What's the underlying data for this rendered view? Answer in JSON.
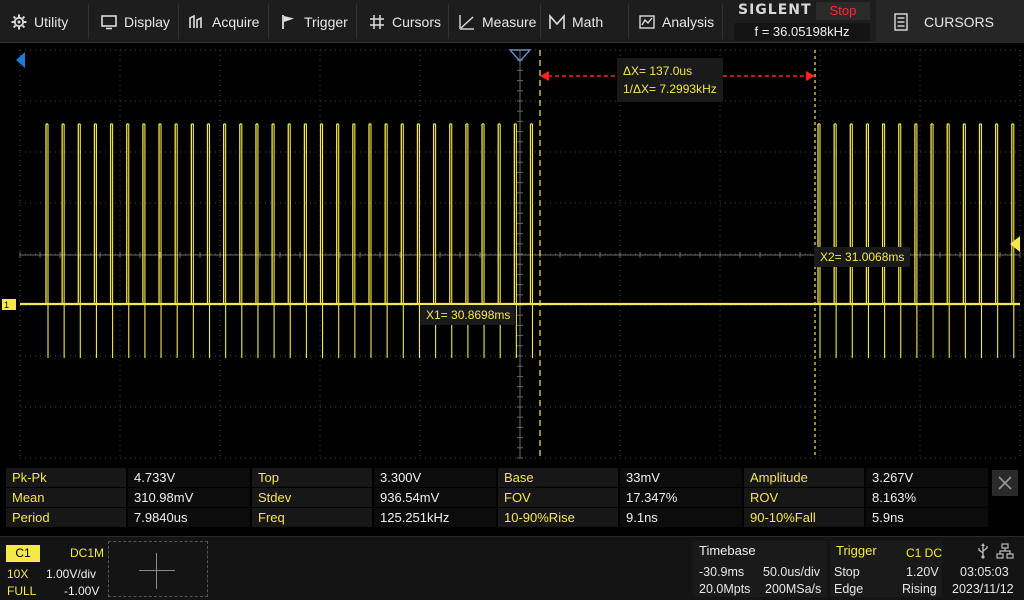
{
  "menu": {
    "items": [
      {
        "label": "Utility",
        "icon": "gear-icon"
      },
      {
        "label": "Display",
        "icon": "display-icon"
      },
      {
        "label": "Acquire",
        "icon": "acquire-icon"
      },
      {
        "label": "Trigger",
        "icon": "flag-icon"
      },
      {
        "label": "Cursors",
        "icon": "crosshair-icon"
      },
      {
        "label": "Measure",
        "icon": "measure-icon"
      },
      {
        "label": "Math",
        "icon": "math-icon"
      },
      {
        "label": "Analysis",
        "icon": "analysis-icon"
      }
    ]
  },
  "brand": {
    "logo": "SIGLENT",
    "status": "Stop",
    "freq": "f = 36.05198kHz"
  },
  "panel_button": {
    "label": "CURSORS",
    "icon": "menu-list-icon"
  },
  "cursors": {
    "delta_x": "ΔX= 137.0us",
    "inv_delta_x": "1/ΔX= 7.2993kHz",
    "x1": "X1= 30.8698ms",
    "x2": "X2= 31.0068ms"
  },
  "measurements": [
    [
      {
        "label": "Pk-Pk",
        "value": "4.733V"
      },
      {
        "label": "Top",
        "value": "3.300V"
      },
      {
        "label": "Base",
        "value": "33mV"
      },
      {
        "label": "Amplitude",
        "value": "3.267V"
      }
    ],
    [
      {
        "label": "Mean",
        "value": "310.98mV"
      },
      {
        "label": "Stdev",
        "value": "936.54mV"
      },
      {
        "label": "FOV",
        "value": "17.347%"
      },
      {
        "label": "ROV",
        "value": "8.163%"
      }
    ],
    [
      {
        "label": "Period",
        "value": "7.9840us"
      },
      {
        "label": "Freq",
        "value": "125.251kHz"
      },
      {
        "label": "10-90%Rise",
        "value": "9.1ns"
      },
      {
        "label": "90-10%Fall",
        "value": "5.9ns"
      }
    ]
  ],
  "channel1": {
    "name": "C1",
    "coupling": "DC1M",
    "probe": "10X",
    "scale": "1.00V/div",
    "bandwidth": "FULL",
    "offset": "-1.00V"
  },
  "timebase": {
    "title": "Timebase",
    "delay": "-30.9ms",
    "scale": "50.0us/div",
    "memory": "20.0Mpts",
    "sample_rate": "200MSa/s"
  },
  "trigger": {
    "title": "Trigger",
    "source": "C1 DC",
    "mode": "Stop",
    "level": "1.20V",
    "type": "Edge",
    "slope": "Rising"
  },
  "clock": {
    "time": "03:05:03",
    "date": "2023/11/12"
  },
  "colors": {
    "channel1": "#f4e84a",
    "cursor_delta": "#ff2020",
    "trigger_marker": "#f4e84a",
    "position_marker": "#1e7bd6",
    "status_stop": "#ff2e2e"
  }
}
